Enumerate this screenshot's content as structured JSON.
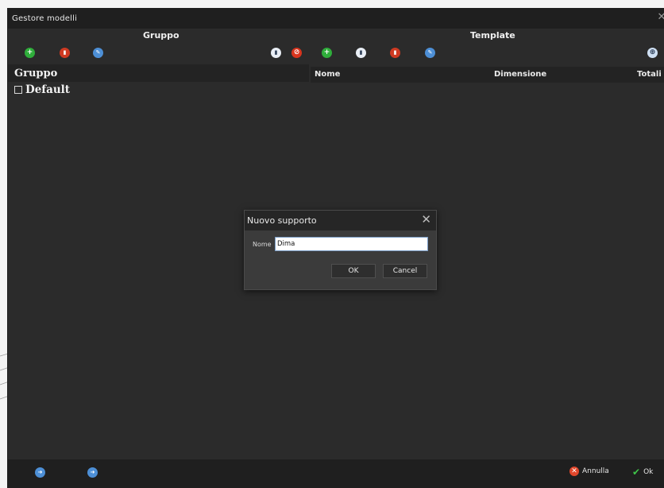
{
  "window": {
    "title": "Gestore modelli",
    "close_glyph": "✕"
  },
  "gruppo_section": {
    "title": "Gruppo",
    "column_header": "Gruppo",
    "items": [
      {
        "label": "Default"
      }
    ]
  },
  "template_section": {
    "title": "Template",
    "columns": [
      "Nome",
      "Dimensione",
      "Totali"
    ]
  },
  "toolbar_icons": {
    "add": "+",
    "delete": "🗑",
    "edit": "✎",
    "copy": "▣",
    "cancel": "⊘",
    "settings": "⊕"
  },
  "bottom": {
    "annulla_label": "Annulla",
    "ok_label": "Ok"
  },
  "dialog": {
    "title": "Nuovo supporto",
    "close_glyph": "✕",
    "name_label": "Nome",
    "name_value": "Dima",
    "ok_label": "OK",
    "cancel_label": "Cancel"
  },
  "colors": {
    "window_bg": "#2b2b2b",
    "titlebar_bg": "#1f1f1f",
    "green": "#2fae3b",
    "red": "#cf3a22",
    "blue": "#4d8fd6"
  }
}
